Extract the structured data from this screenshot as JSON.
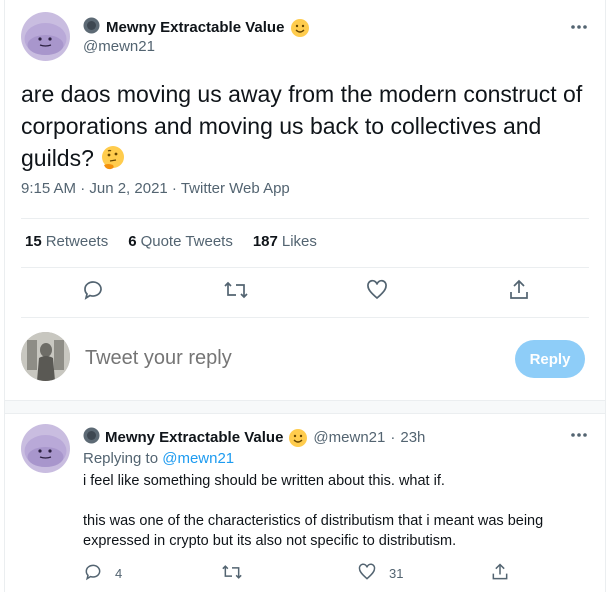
{
  "main_tweet": {
    "display_name": "Mewny Extractable Value",
    "handle": "@mewn21",
    "text": "are daos moving us away from the modern construct of corporations and moving us back to collectives and guilds?",
    "timestamp": "9:15 AM · Jun 2, 2021 · Twitter Web App",
    "stats": {
      "retweets_count": "15",
      "retweets_label": "Retweets",
      "quotes_count": "6",
      "quotes_label": "Quote Tweets",
      "likes_count": "187",
      "likes_label": "Likes"
    }
  },
  "reply_composer": {
    "placeholder": "Tweet your reply",
    "button_label": "Reply"
  },
  "reply_tweet": {
    "display_name": "Mewny Extractable Value",
    "handle": "@mewn21",
    "separator": "·",
    "time": "23h",
    "replying_prefix": "Replying to",
    "replying_to": "@mewn21",
    "paragraph1": "i feel like something should be written about this. what if.",
    "paragraph2": "this was one of the characteristics of distributism that i meant was being expressed in crypto but its also not specific to distributism.",
    "reply_count": "4",
    "like_count": "31"
  },
  "colors": {
    "accent": "#1d9bf0",
    "reply_button_disabled": "#8ecdf8",
    "muted_text": "#536471"
  },
  "icons": [
    "more-icon",
    "smile-emoji",
    "thinking-emoji",
    "reply-icon",
    "retweet-icon",
    "like-icon",
    "share-icon",
    "moon-badge-icon"
  ]
}
